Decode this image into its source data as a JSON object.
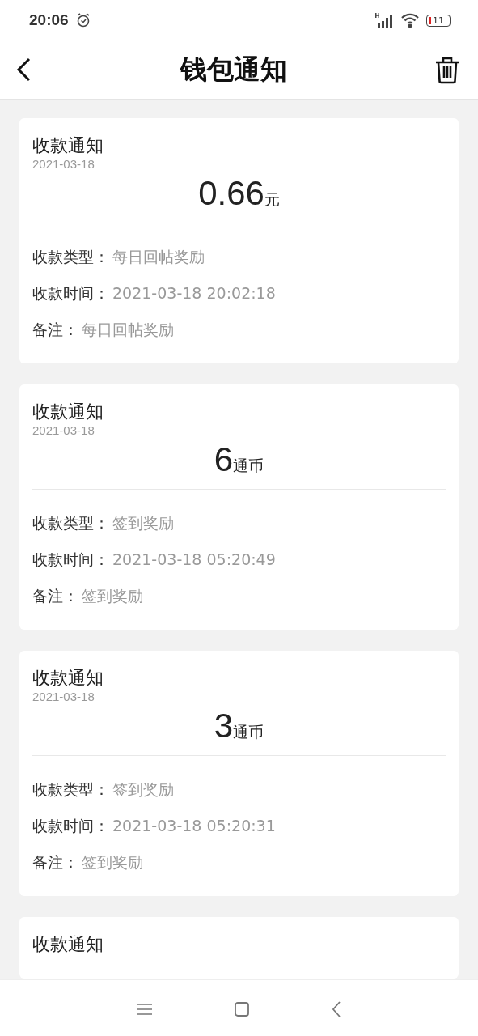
{
  "status_bar": {
    "time": "20:06",
    "battery": "11"
  },
  "header": {
    "title": "钱包通知"
  },
  "notifications": [
    {
      "title": "收款通知",
      "date": "2021-03-18",
      "amount": "0.66",
      "unit": "元",
      "fields": [
        {
          "label": "收款类型：",
          "value": "每日回帖奖励"
        },
        {
          "label": "收款时间：",
          "value": "2021-03-18 20:02:18"
        },
        {
          "label": "备注：",
          "value": "每日回帖奖励"
        }
      ]
    },
    {
      "title": "收款通知",
      "date": "2021-03-18",
      "amount": "6",
      "unit": "通币",
      "fields": [
        {
          "label": "收款类型：",
          "value": "签到奖励"
        },
        {
          "label": "收款时间：",
          "value": "2021-03-18 05:20:49"
        },
        {
          "label": "备注：",
          "value": "签到奖励"
        }
      ]
    },
    {
      "title": "收款通知",
      "date": "2021-03-18",
      "amount": "3",
      "unit": "通币",
      "fields": [
        {
          "label": "收款类型：",
          "value": "签到奖励"
        },
        {
          "label": "收款时间：",
          "value": "2021-03-18 05:20:31"
        },
        {
          "label": "备注：",
          "value": "签到奖励"
        }
      ]
    },
    {
      "title": "收款通知"
    }
  ]
}
